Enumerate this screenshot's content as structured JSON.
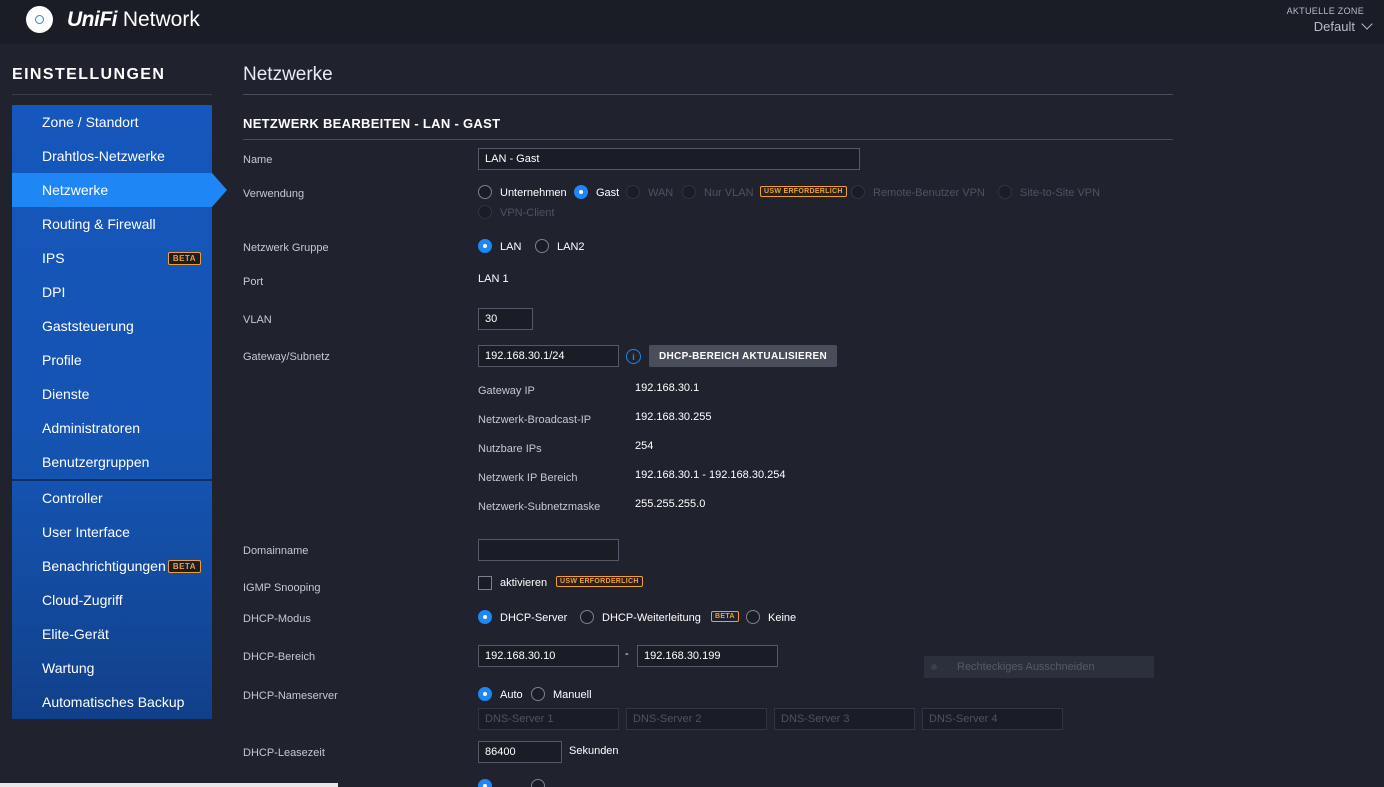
{
  "header": {
    "brand_part1": "UniFi",
    "brand_part2": " Network",
    "zone_label": "AKTUELLE ZONE",
    "zone_value": "Default"
  },
  "sidebar": {
    "title": "EINSTELLUNGEN",
    "group1": [
      {
        "label": "Zone / Standort"
      },
      {
        "label": "Drahtlos-Netzwerke"
      },
      {
        "label": "Netzwerke",
        "active": true
      },
      {
        "label": "Routing & Firewall"
      },
      {
        "label": "IPS",
        "badge": "BETA"
      },
      {
        "label": "DPI"
      },
      {
        "label": "Gaststeuerung"
      },
      {
        "label": "Profile"
      },
      {
        "label": "Dienste"
      },
      {
        "label": "Administratoren"
      },
      {
        "label": "Benutzergruppen"
      }
    ],
    "group2": [
      {
        "label": "Controller"
      },
      {
        "label": "User Interface"
      },
      {
        "label": "Benachrichtigungen",
        "badge": "BETA"
      },
      {
        "label": "Cloud-Zugriff"
      },
      {
        "label": "Elite-Gerät"
      },
      {
        "label": "Wartung"
      },
      {
        "label": "Automatisches Backup"
      }
    ]
  },
  "main": {
    "page_title": "Netzwerke",
    "sub_title": "NETZWERK BEARBEITEN - LAN - GAST",
    "name": {
      "label": "Name",
      "value": "LAN - Gast"
    },
    "verwendung": {
      "label": "Verwendung",
      "options": [
        "Unternehmen",
        "Gast",
        "WAN",
        "Nur VLAN",
        "Remote-Benutzer VPN",
        "Site-to-Site VPN",
        "VPN-Client"
      ],
      "selected": "Gast",
      "usw_badge": "USW ERFORDERLICH"
    },
    "netzwerk_gruppe": {
      "label": "Netzwerk Gruppe",
      "options": [
        "LAN",
        "LAN2"
      ],
      "selected": "LAN"
    },
    "port": {
      "label": "Port",
      "value": "LAN 1"
    },
    "vlan": {
      "label": "VLAN",
      "value": "30"
    },
    "gateway": {
      "label": "Gateway/Subnetz",
      "value": "192.168.30.1/24",
      "info_glyph": "i",
      "button": "DHCP-BEREICH AKTUALISIEREN",
      "details": [
        {
          "label": "Gateway IP",
          "value": "192.168.30.1"
        },
        {
          "label": "Netzwerk-Broadcast-IP",
          "value": "192.168.30.255"
        },
        {
          "label": "Nutzbare IPs",
          "value": "254"
        },
        {
          "label": "Netzwerk IP Bereich",
          "value": "192.168.30.1 - 192.168.30.254"
        },
        {
          "label": "Netzwerk-Subnetzmaske",
          "value": "255.255.255.0"
        }
      ]
    },
    "domainname": {
      "label": "Domainname",
      "value": ""
    },
    "igmp": {
      "label": "IGMP Snooping",
      "checkbox_label": "aktivieren",
      "badge": "USW ERFORDERLICH"
    },
    "dhcp_modus": {
      "label": "DHCP-Modus",
      "options": [
        "DHCP-Server",
        "DHCP-Weiterleitung",
        "Keine"
      ],
      "selected": "DHCP-Server",
      "badge": "BETA"
    },
    "dhcp_bereich": {
      "label": "DHCP-Bereich",
      "start": "192.168.30.10",
      "separator": "-",
      "end": "192.168.30.199"
    },
    "dhcp_nameserver": {
      "label": "DHCP-Nameserver",
      "options": [
        "Auto",
        "Manuell"
      ],
      "selected": "Auto",
      "placeholders": [
        "DNS-Server 1",
        "DNS-Server 2",
        "DNS-Server 3",
        "DNS-Server 4"
      ]
    },
    "lease": {
      "label": "DHCP-Leasezeit",
      "value": "86400",
      "unit": "Sekunden"
    },
    "ghost_tooltip": "Rechteckiges Ausschneiden"
  }
}
